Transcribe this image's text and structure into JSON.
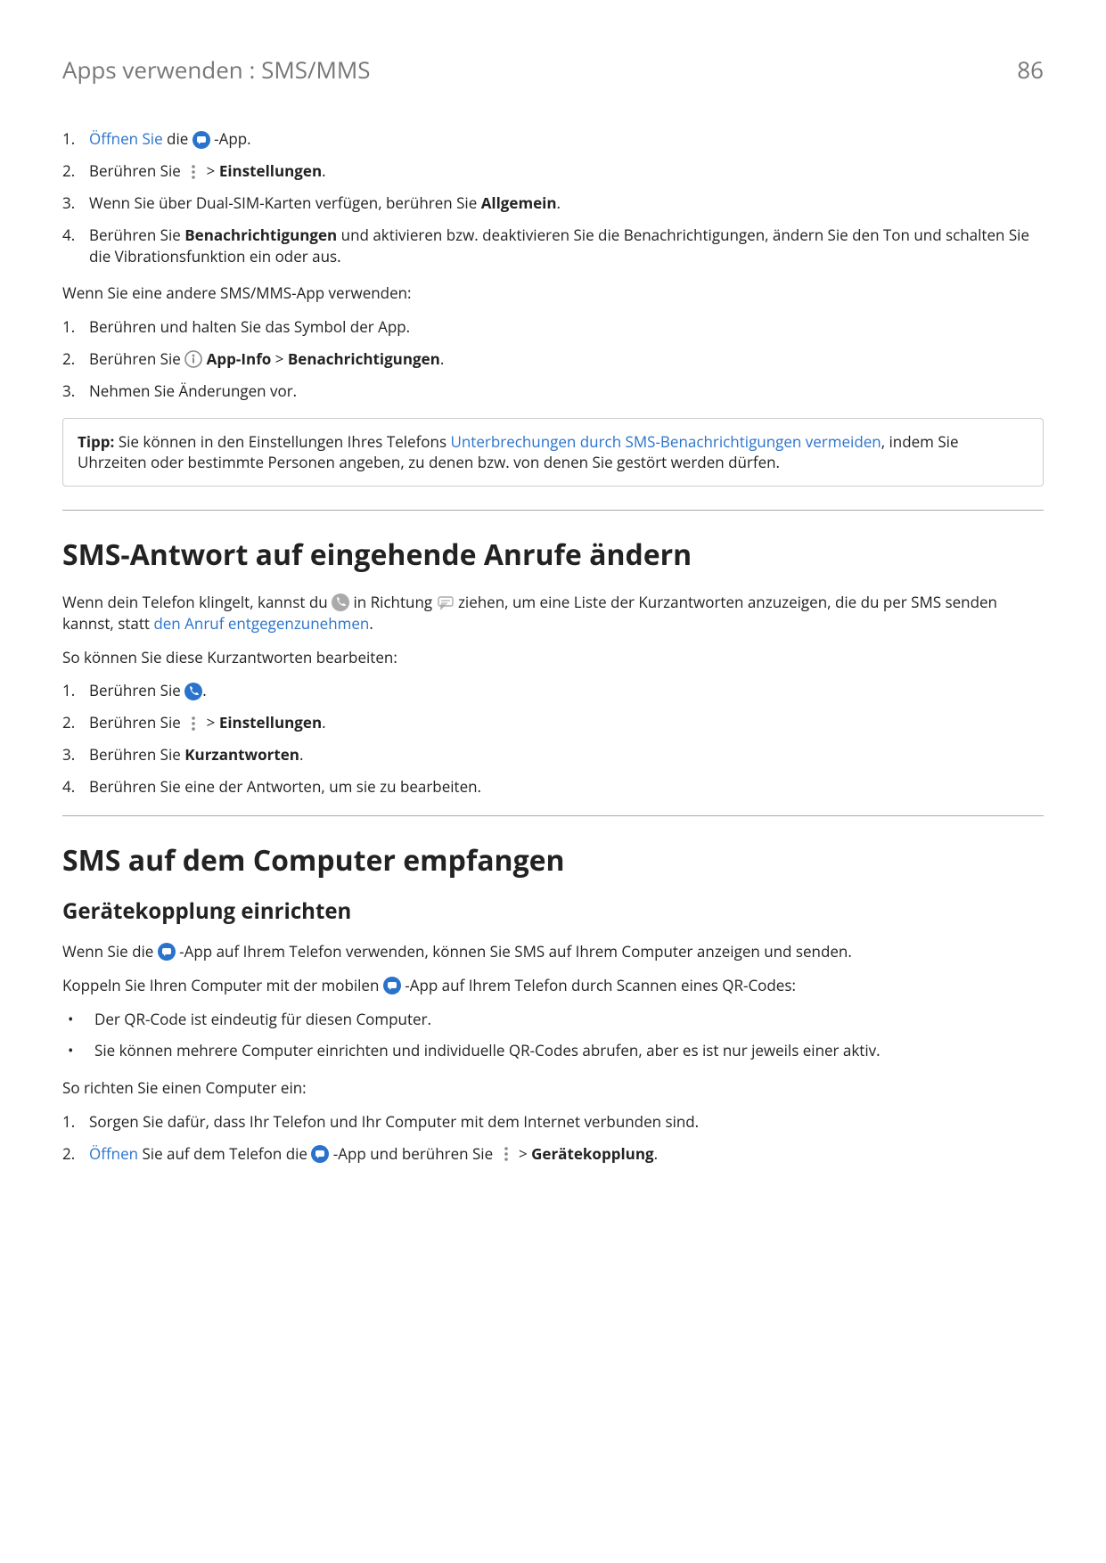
{
  "header": {
    "breadcrumb": "Apps verwenden : SMS/MMS",
    "page": "86"
  },
  "colors": {
    "link": "#2a73cc",
    "grey": "#777"
  },
  "listA": {
    "i1": {
      "n": "1.",
      "link": "Öffnen Sie",
      "t1": " die ",
      "t2": " -App."
    },
    "i2": {
      "n": "2.",
      "t1": "Berühren Sie ",
      "t2": " > ",
      "b": "Einstellungen",
      "t3": "."
    },
    "i3": {
      "n": "3.",
      "t1": "Wenn Sie über Dual-SIM-Karten verfügen, berühren Sie ",
      "b": "Allgemein",
      "t2": "."
    },
    "i4": {
      "n": "4.",
      "t1": "Berühren Sie ",
      "b": "Benachrichtigungen",
      "t2": " und aktivieren bzw. deaktivieren Sie die Benachrichtigungen, ändern Sie den Ton und schalten Sie die Vibrationsfunktion ein oder aus."
    }
  },
  "paraA": "Wenn Sie eine andere SMS/MMS-App verwenden:",
  "listB": {
    "i1": {
      "n": "1.",
      "t": "Berühren und halten Sie das Symbol der App."
    },
    "i2": {
      "n": "2.",
      "t1": "Berühren Sie ",
      "b1": "App-Info",
      "t2": " > ",
      "b2": "Benachrichtigungen",
      "t3": "."
    },
    "i3": {
      "n": "3.",
      "t": "Nehmen Sie Änderungen vor."
    }
  },
  "tip": {
    "b": "Tipp:",
    "t1": " Sie können in den Einstellungen Ihres Telefons ",
    "link": "Unterbrechungen durch SMS-Benachrichtigungen vermeiden",
    "t2": ", indem Sie Uhrzeiten oder bestimmte Personen angeben, zu denen bzw. von denen Sie gestört werden dürfen."
  },
  "h2a": "SMS-Antwort auf eingehende Anrufe ändern",
  "paraB": {
    "t1": "Wenn dein Telefon klingelt, kannst du ",
    "t2": " in Richtung ",
    "t3": " ziehen, um eine Liste der Kurzantworten anzuzeigen, die du per SMS senden kannst, statt ",
    "link": "den Anruf entgegenzunehmen",
    "t4": "."
  },
  "paraC": "So können Sie diese Kurzantworten bearbeiten:",
  "listC": {
    "i1": {
      "n": "1.",
      "t1": "Berühren Sie ",
      "t2": "."
    },
    "i2": {
      "n": "2.",
      "t1": "Berühren Sie ",
      "t2": " > ",
      "b": "Einstellungen",
      "t3": "."
    },
    "i3": {
      "n": "3.",
      "t1": "Berühren Sie ",
      "b": "Kurzantworten",
      "t2": "."
    },
    "i4": {
      "n": "4.",
      "t": "Berühren Sie eine der Antworten, um sie zu bearbeiten."
    }
  },
  "h2b": "SMS auf dem Computer empfangen",
  "h3a": "Gerätekopplung einrichten",
  "paraD": {
    "t1": "Wenn Sie die ",
    "t2": " -App auf Ihrem Telefon verwenden, können Sie SMS auf Ihrem Computer anzeigen und senden."
  },
  "paraE": {
    "t1": "Koppeln Sie Ihren Computer mit der mobilen ",
    "t2": " -App auf Ihrem Telefon durch Scannen eines QR-Codes:"
  },
  "bullets": {
    "i1": "Der QR-Code ist eindeutig für diesen Computer.",
    "i2": "Sie können mehrere Computer einrichten und individuelle QR-Codes abrufen, aber es ist nur jeweils einer aktiv."
  },
  "paraF": "So richten Sie einen Computer ein:",
  "listD": {
    "i1": {
      "n": "1.",
      "t": "Sorgen Sie dafür, dass Ihr Telefon und Ihr Computer mit dem Internet verbunden sind."
    },
    "i2": {
      "n": "2.",
      "link": "Öffnen",
      "t1": " Sie auf dem Telefon die ",
      "t2": " -App und berühren Sie ",
      "t3": " > ",
      "b": "Gerätekopplung",
      "t4": "."
    }
  }
}
